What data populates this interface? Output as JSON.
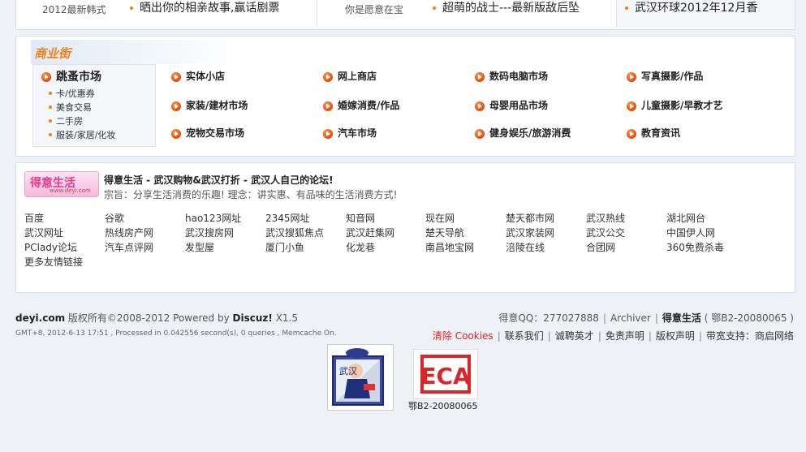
{
  "top": {
    "col1_caption": "2012最新韩式",
    "col1_link": "晒出你的相亲故事,赢话剧票",
    "col2_caption": "你是愿意在宝",
    "col2_link": "超萌的战士---最新版敌后坠",
    "col3_link": "武汉环球2012年12月香"
  },
  "biz": {
    "title": "商业街",
    "flea": {
      "title": "跳蚤市场",
      "items": [
        "卡/优惠券",
        "美食交易",
        "二手房",
        "服装/家居/化妆"
      ]
    },
    "items": [
      "实体小店",
      "网上商店",
      "数码电脑市场",
      "写真摄影/作品",
      "家装/建材市场",
      "婚嫁消费/作品",
      "母婴用品市场",
      "儿童摄影/早教才艺",
      "宠物交易市场",
      "汽车市场",
      "健身娱乐/旅游消费",
      "教育资讯"
    ]
  },
  "links": {
    "logo_text": "得意生活",
    "logo_sub": "www.deyi.com",
    "site_title": "得意生活 - 武汉购物&武汉打折 - 武汉人自己的论坛!",
    "site_slogan": "宗旨：分享生活消费的乐趣! 理念：讲实惠、有品味的生活消费方式!",
    "items": [
      "百度",
      "谷歌",
      "hao123网址",
      "2345网址",
      "知音网",
      "现在网",
      "楚天都市网",
      "武汉热线",
      "湖北网台",
      "武汉网址",
      "热线房产网",
      "武汉搜房网",
      "武汉搜狐焦点",
      "武汉赶集网",
      "楚天导航",
      "武汉家装网",
      "武汉公交",
      "中国伊人网",
      "PClady论坛",
      "汽车点评网",
      "发型屋",
      "厦门小鱼",
      "化龙巷",
      "南昌地宝网",
      "涪陵在线",
      "合团网",
      "360免费杀毒",
      "更多友情链接"
    ]
  },
  "footer": {
    "site": "deyi.com",
    "copyright": "版权所有©2008-2012 Powered by",
    "engine": "Discuz!",
    "version": "X1.5",
    "info": "GMT+8, 2012-6-13 17:51 , Processed in 0.042556 second(s), 0 queries , Memcache On.",
    "qq_label": "得意QQ：",
    "qq_value": "277027888",
    "archiver": "Archiver",
    "site_name": "得意生活",
    "license": "( 鄂B2-20080065 )",
    "clear_cookies": "清除 Cookies",
    "contact": "联系我们",
    "hiring": "诚聘英才",
    "disclaimer": "免责声明",
    "copyright_notice": "版权声明",
    "bandwidth": "带宽支持：商启网络",
    "badge_police_text": "武汉",
    "badge_eca_text": "ECA",
    "badge_eca_caption": "鄂B2-20080065"
  },
  "colors": {
    "accent_orange": "#f07e1a",
    "clear_cookies_red": "#dd2222",
    "panel_border": "#d8dde6"
  }
}
